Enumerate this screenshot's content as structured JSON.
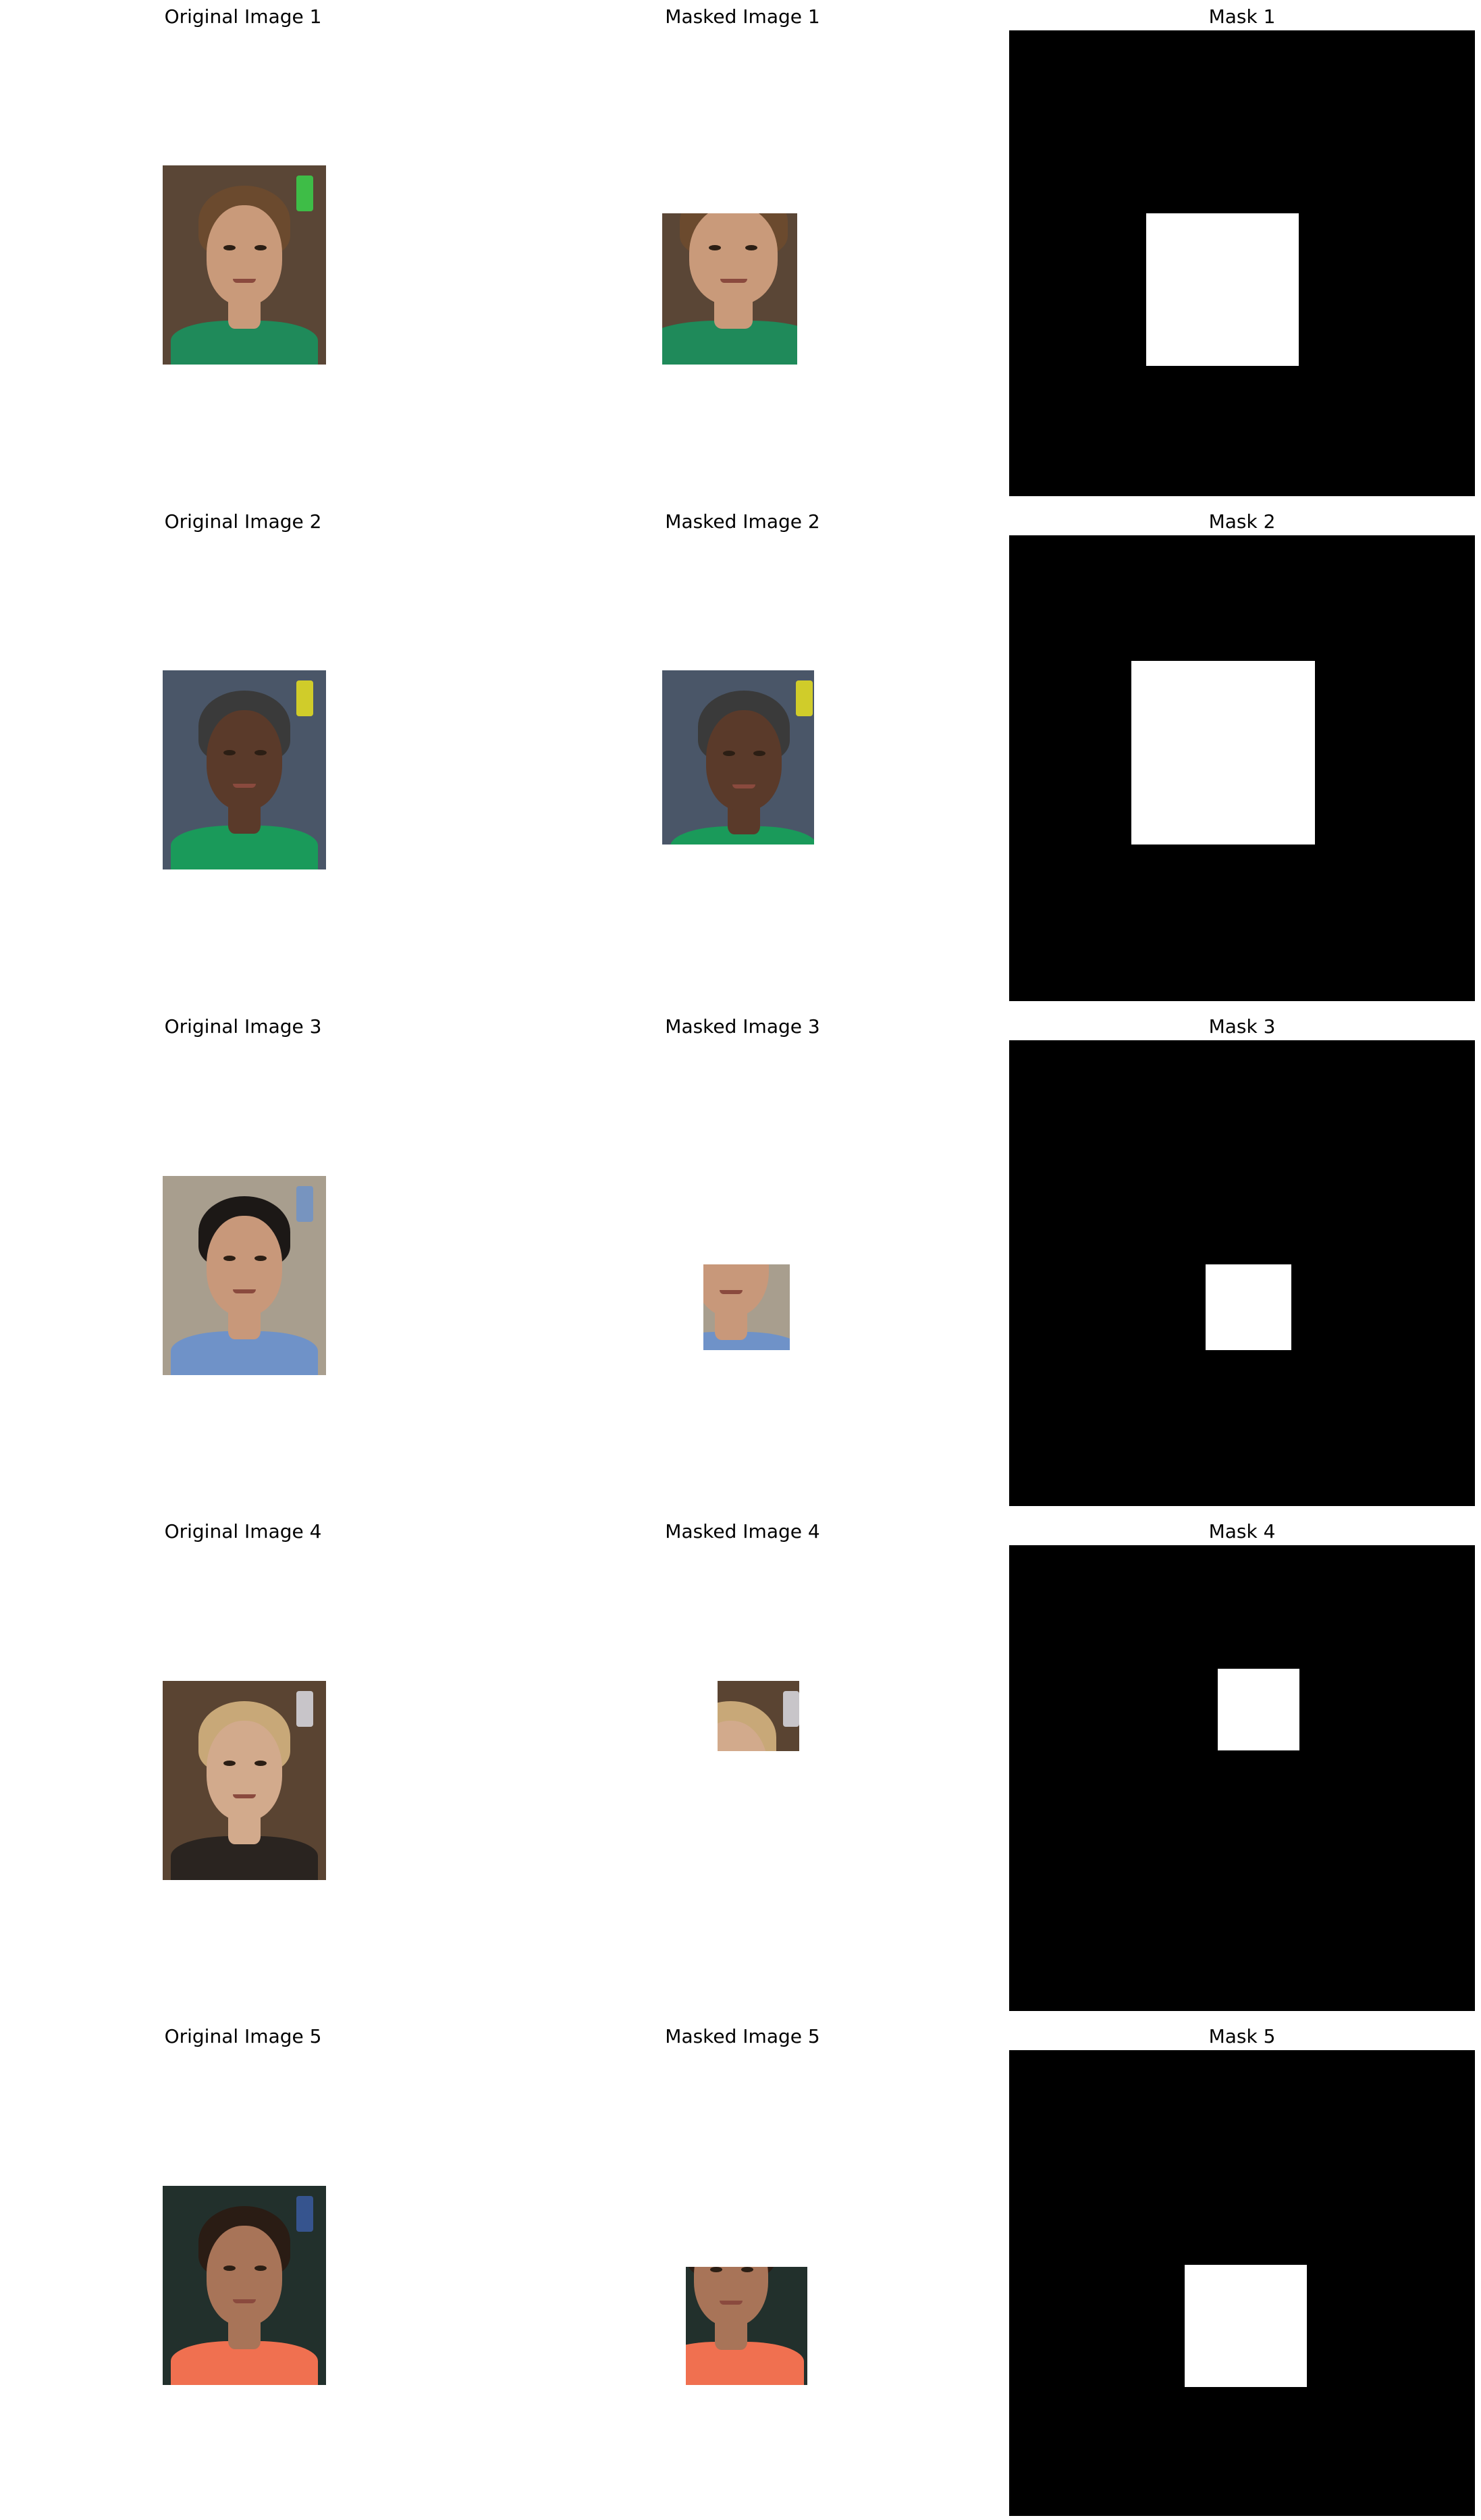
{
  "rows": [
    {
      "original_title": "Original Image 1",
      "masked_title": "Masked Image 1",
      "mask_title": "Mask 1",
      "photo": {
        "bg": "#5a4636",
        "skin": "#c99a7a",
        "hair": "#6b4a2e",
        "shirt": "#1f8a5a",
        "accent": "#39d24a"
      }
    },
    {
      "original_title": "Original Image 2",
      "masked_title": "Masked Image 2",
      "mask_title": "Mask 2",
      "photo": {
        "bg": "#4a5668",
        "skin": "#5a3a2a",
        "hair": "#3a3a3a",
        "shirt": "#1a9a5a",
        "accent": "#e8e020"
      }
    },
    {
      "original_title": "Original Image 3",
      "masked_title": "Masked Image 3",
      "mask_title": "Mask 3",
      "photo": {
        "bg": "#a89e8e",
        "skin": "#c8987a",
        "hair": "#1c1816",
        "shirt": "#6f92c8",
        "accent": "#6f92c8"
      }
    },
    {
      "original_title": "Original Image 4",
      "masked_title": "Masked Image 4",
      "mask_title": "Mask 4",
      "photo": {
        "bg": "#5a4432",
        "skin": "#d2aa8c",
        "hair": "#c8a878",
        "shirt": "#2a2420",
        "accent": "#dcdce4"
      }
    },
    {
      "original_title": "Original Image 5",
      "masked_title": "Masked Image 5",
      "mask_title": "Mask 5",
      "photo": {
        "bg": "#22302c",
        "skin": "#a87458",
        "hair": "#2a1c14",
        "shirt": "#f07050",
        "accent": "#3a5aa0"
      }
    }
  ]
}
